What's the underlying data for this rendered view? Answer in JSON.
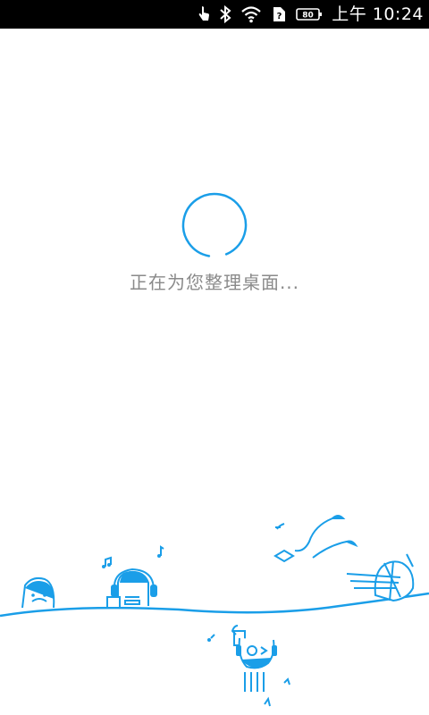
{
  "status_bar": {
    "time": "上午 10:24",
    "battery_level": "80",
    "icons": [
      "touch-icon",
      "bluetooth-icon",
      "wifi-icon",
      "sim-unknown-icon",
      "battery-icon"
    ]
  },
  "loading": {
    "message": "正在为您整理桌面..."
  },
  "colors": {
    "accent": "#1a9ee8",
    "text_muted": "#8a8a8a",
    "status_bar": "#000000"
  }
}
